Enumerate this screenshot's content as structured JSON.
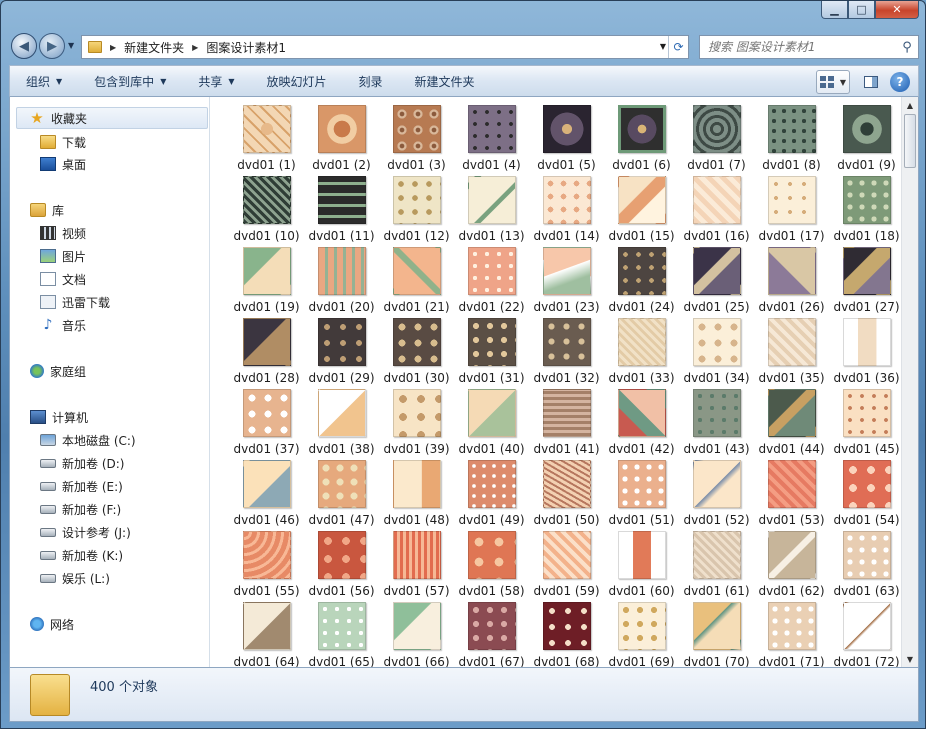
{
  "window": {
    "minimize": "▁",
    "maximize": "□",
    "close": "✕"
  },
  "address": {
    "crumbs": [
      "新建文件夹",
      "图案设计素材1"
    ],
    "search_placeholder": "搜索 图案设计素材1"
  },
  "toolbar": {
    "organize": "组织",
    "include": "包含到库中",
    "share": "共享",
    "slideshow": "放映幻灯片",
    "burn": "刻录",
    "new_folder": "新建文件夹"
  },
  "sidebar": {
    "favorites": "收藏夹",
    "downloads": "下载",
    "desktop": "桌面",
    "libraries": "库",
    "videos": "视频",
    "pictures": "图片",
    "documents": "文档",
    "xunlei": "迅雷下载",
    "music": "音乐",
    "homegroup": "家庭组",
    "computer": "计算机",
    "drives": [
      "本地磁盘 (C:)",
      "新加卷 (D:)",
      "新加卷 (E:)",
      "新加卷 (F:)",
      "设计参考 (J:)",
      "新加卷 (K:)",
      "娱乐 (L:)"
    ],
    "network": "网络"
  },
  "files": [
    "dvd01 (1)",
    "dvd01 (2)",
    "dvd01 (3)",
    "dvd01 (4)",
    "dvd01 (5)",
    "dvd01 (6)",
    "dvd01 (7)",
    "dvd01 (8)",
    "dvd01 (9)",
    "dvd01 (10)",
    "dvd01 (11)",
    "dvd01 (12)",
    "dvd01 (13)",
    "dvd01 (14)",
    "dvd01 (15)",
    "dvd01 (16)",
    "dvd01 (17)",
    "dvd01 (18)",
    "dvd01 (19)",
    "dvd01 (20)",
    "dvd01 (21)",
    "dvd01 (22)",
    "dvd01 (23)",
    "dvd01 (24)",
    "dvd01 (25)",
    "dvd01 (26)",
    "dvd01 (27)",
    "dvd01 (28)",
    "dvd01 (29)",
    "dvd01 (30)",
    "dvd01 (31)",
    "dvd01 (32)",
    "dvd01 (33)",
    "dvd01 (34)",
    "dvd01 (35)",
    "dvd01 (36)",
    "dvd01 (37)",
    "dvd01 (38)",
    "dvd01 (39)",
    "dvd01 (40)",
    "dvd01 (41)",
    "dvd01 (42)",
    "dvd01 (43)",
    "dvd01 (44)",
    "dvd01 (45)",
    "dvd01 (46)",
    "dvd01 (47)",
    "dvd01 (48)",
    "dvd01 (49)",
    "dvd01 (50)",
    "dvd01 (51)",
    "dvd01 (52)",
    "dvd01 (53)",
    "dvd01 (54)",
    "dvd01 (55)",
    "dvd01 (56)",
    "dvd01 (57)",
    "dvd01 (58)",
    "dvd01 (59)",
    "dvd01 (60)",
    "dvd01 (61)",
    "dvd01 (62)",
    "dvd01 (63)",
    "dvd01 (64)",
    "dvd01 (65)",
    "dvd01 (66)",
    "dvd01 (67)",
    "dvd01 (68)",
    "dvd01 (69)",
    "dvd01 (70)",
    "dvd01 (71)",
    "dvd01 (72)"
  ],
  "status": {
    "count": "400 个对象"
  }
}
